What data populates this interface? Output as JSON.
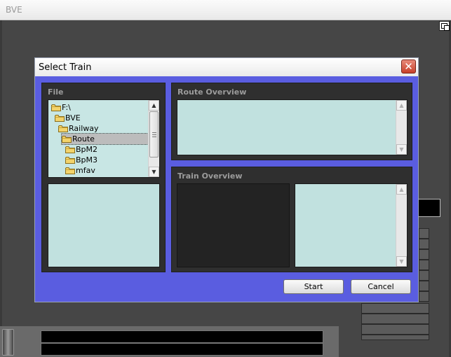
{
  "main_window": {
    "title": "BVE"
  },
  "dialog": {
    "title": "Select Train",
    "close_label": "✕",
    "file_group": {
      "label": "File",
      "tree": [
        {
          "label": "F:\\",
          "indent": 0,
          "selected": false
        },
        {
          "label": "BVE",
          "indent": 1,
          "selected": false
        },
        {
          "label": "Railway",
          "indent": 2,
          "selected": false
        },
        {
          "label": "Route",
          "indent": 3,
          "selected": true
        },
        {
          "label": "BpM2",
          "indent": 4,
          "selected": false
        },
        {
          "label": "BpM3",
          "indent": 4,
          "selected": false
        },
        {
          "label": "mfav",
          "indent": 4,
          "selected": false
        }
      ]
    },
    "route_group": {
      "label": "Route Overview"
    },
    "train_group": {
      "label": "Train Overview"
    },
    "buttons": {
      "start": "Start",
      "cancel": "Cancel"
    }
  },
  "icons": {
    "folder": "folder-icon",
    "close": "close-icon",
    "restore": "restore-icon"
  },
  "colors": {
    "dialog_bg": "#5a5de0",
    "pane_bg": "#c1e1df",
    "group_bg": "#2f2f2f"
  }
}
